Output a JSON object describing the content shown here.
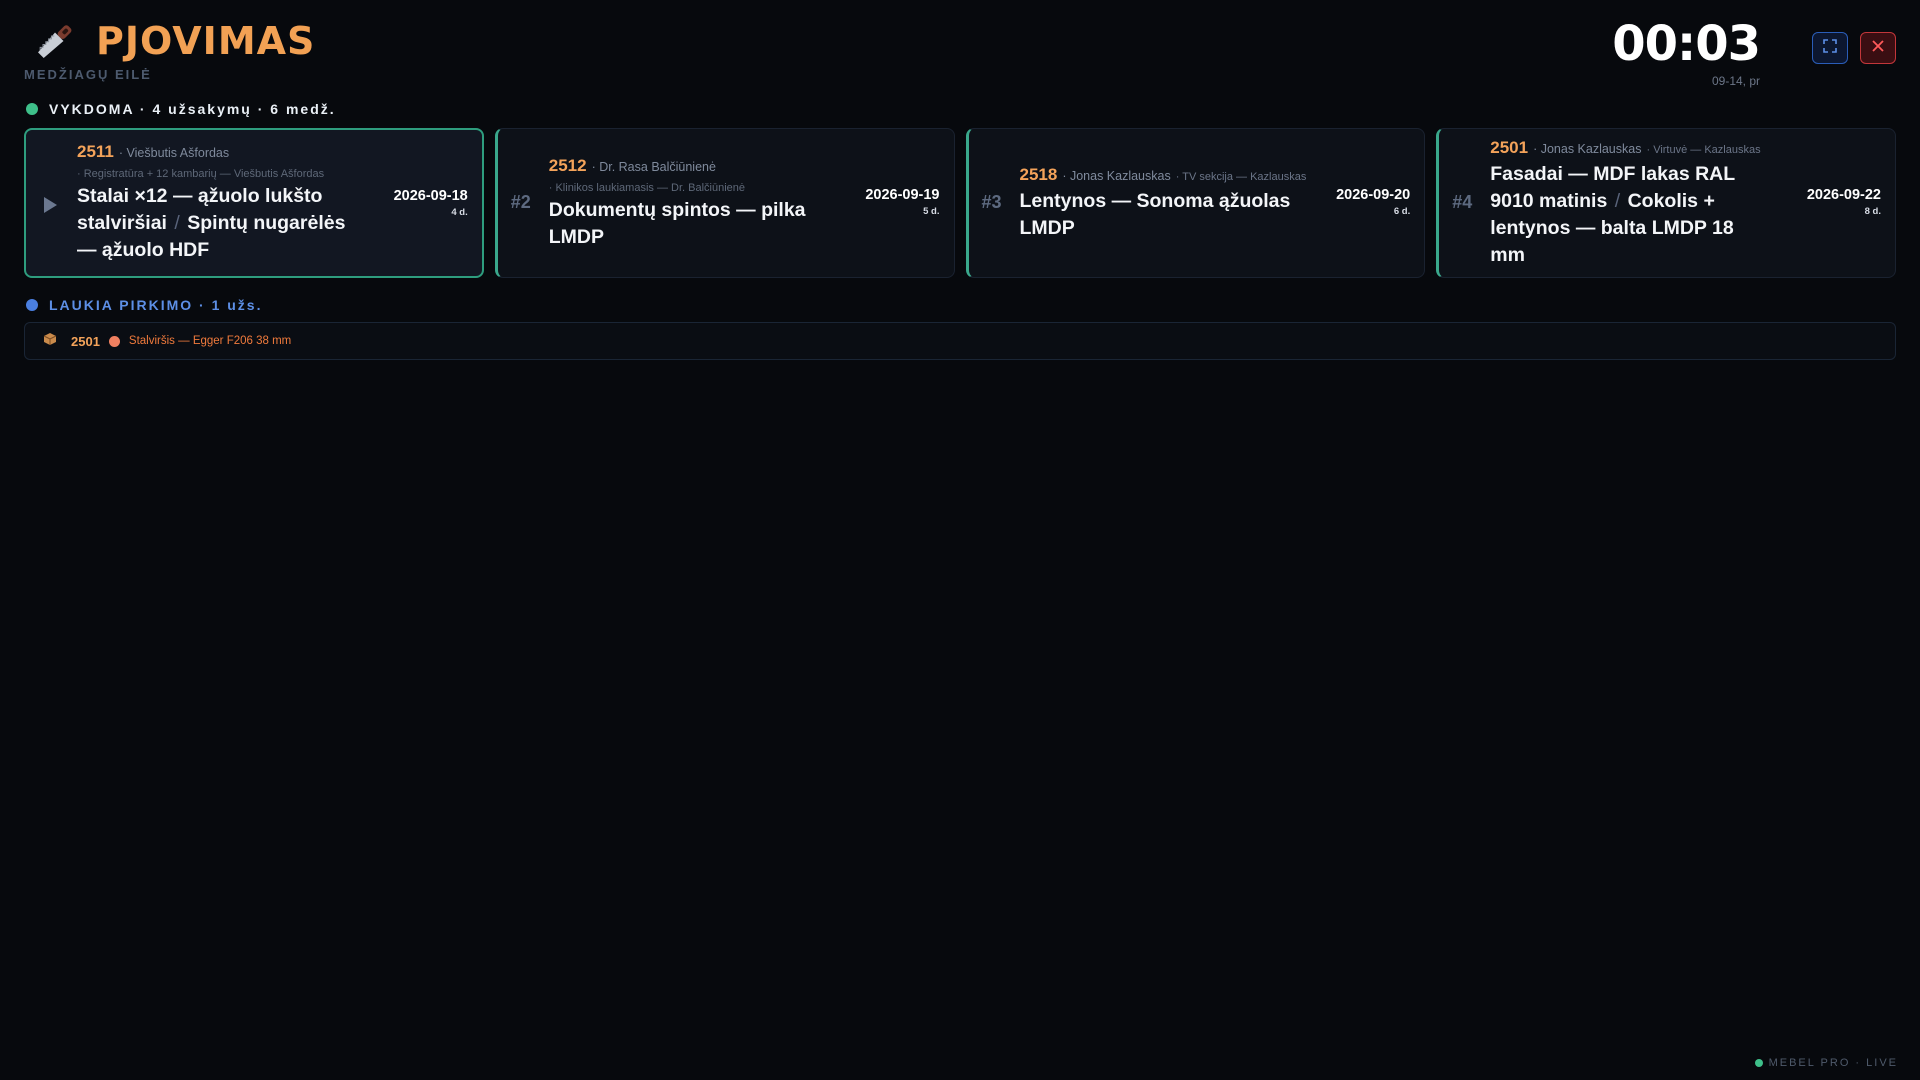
{
  "header": {
    "title": "PJOVIMAS",
    "subtitle": "MEDŽIAGŲ EILĖ",
    "icon": "saw-icon",
    "clock": "00:03",
    "date": "09-14, pr",
    "fullscreen_icon": "fullscreen-icon",
    "close_icon": "close-icon"
  },
  "colors": {
    "accent": "#f2a154",
    "in_progress": "#3ec08a",
    "waiting": "#4a7fe0",
    "card_border": "#3aa88c",
    "material_dot": "#f08060"
  },
  "in_progress": {
    "label": "VYKDOMA · 4 užsakymų · 6 medž.",
    "orders": [
      {
        "marker": "",
        "active": true,
        "id": "2511",
        "client": "· Viešbutis Ašfordas",
        "context": "",
        "subline": "· Registratūra + 12 kambarių — Viešbutis Ašfordas",
        "title_a": "Stalai ×12 — ąžuolo lukšto stalviršiai",
        "title_b": "Spintų nugarėlės — ąžuolo HDF",
        "due": "2026-09-18",
        "days": "4 d."
      },
      {
        "marker": "#2",
        "active": false,
        "id": "2512",
        "client": "· Dr. Rasa Balčiūnienė",
        "context": "",
        "subline": "· Klinikos laukiamasis — Dr. Balčiūnienė",
        "title_a": "Dokumentų spintos — pilka LMDP",
        "title_b": "",
        "due": "2026-09-19",
        "days": "5 d."
      },
      {
        "marker": "#3",
        "active": false,
        "id": "2518",
        "client": "· Jonas Kazlauskas",
        "context": "· TV sekcija — Kazlauskas",
        "subline": "",
        "title_a": "Lentynos — Sonoma ąžuolas LMDP",
        "title_b": "",
        "due": "2026-09-20",
        "days": "6 d."
      },
      {
        "marker": "#4",
        "active": false,
        "id": "2501",
        "client": "· Jonas Kazlauskas",
        "context": "· Virtuvė — Kazlauskas",
        "subline": "",
        "title_a": "Fasadai — MDF lakas RAL 9010 matinis",
        "title_b": "Cokolis + lentynos — balta LMDP 18 mm",
        "due": "2026-09-22",
        "days": "8 d."
      }
    ]
  },
  "waiting": {
    "label": "LAUKIA PIRKIMO · 1 užs.",
    "items": [
      {
        "icon": "package-icon",
        "id": "2501",
        "material": "Stalviršis — Egger F206 38 mm"
      }
    ]
  },
  "footer": {
    "label": "MEBEL PRO · LIVE"
  }
}
